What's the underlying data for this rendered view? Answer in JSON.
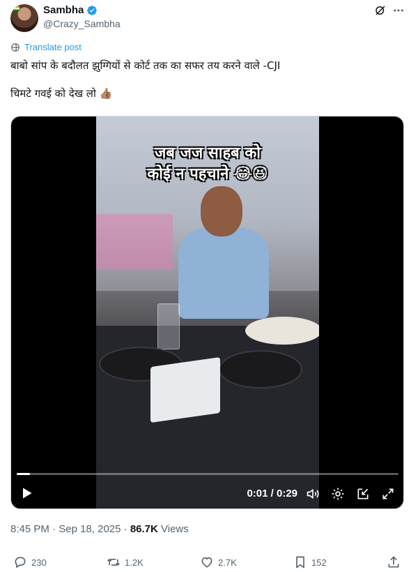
{
  "author": {
    "display_name": "Sambha",
    "handle": "@Crazy_Sambha"
  },
  "translate_label": "Translate post",
  "text": {
    "line1": "बाबो सांप के बदौलत झुग्गियों से कोर्ट तक का सफर तय करने वाले -CJI",
    "line2": "चिमटे गवई को देख लो 👍🏽"
  },
  "video": {
    "caption_line1": "जब जज साहब को",
    "caption_line2": "कोई न पहचाने 😂😆",
    "time": "0:01 / 0:29",
    "progress_fraction": 0.034
  },
  "meta": {
    "time": "8:45 PM",
    "sep1": " · ",
    "date": "Sep 18, 2025",
    "sep2": " · ",
    "views": "86.7K",
    "views_label": " Views"
  },
  "actions": {
    "replies": "230",
    "reposts": "1.2K",
    "likes": "2.7K",
    "bookmarks": "152"
  },
  "colors": {
    "accent": "#1d9bf0",
    "text": "#0f1419",
    "secondary": "#536471"
  }
}
